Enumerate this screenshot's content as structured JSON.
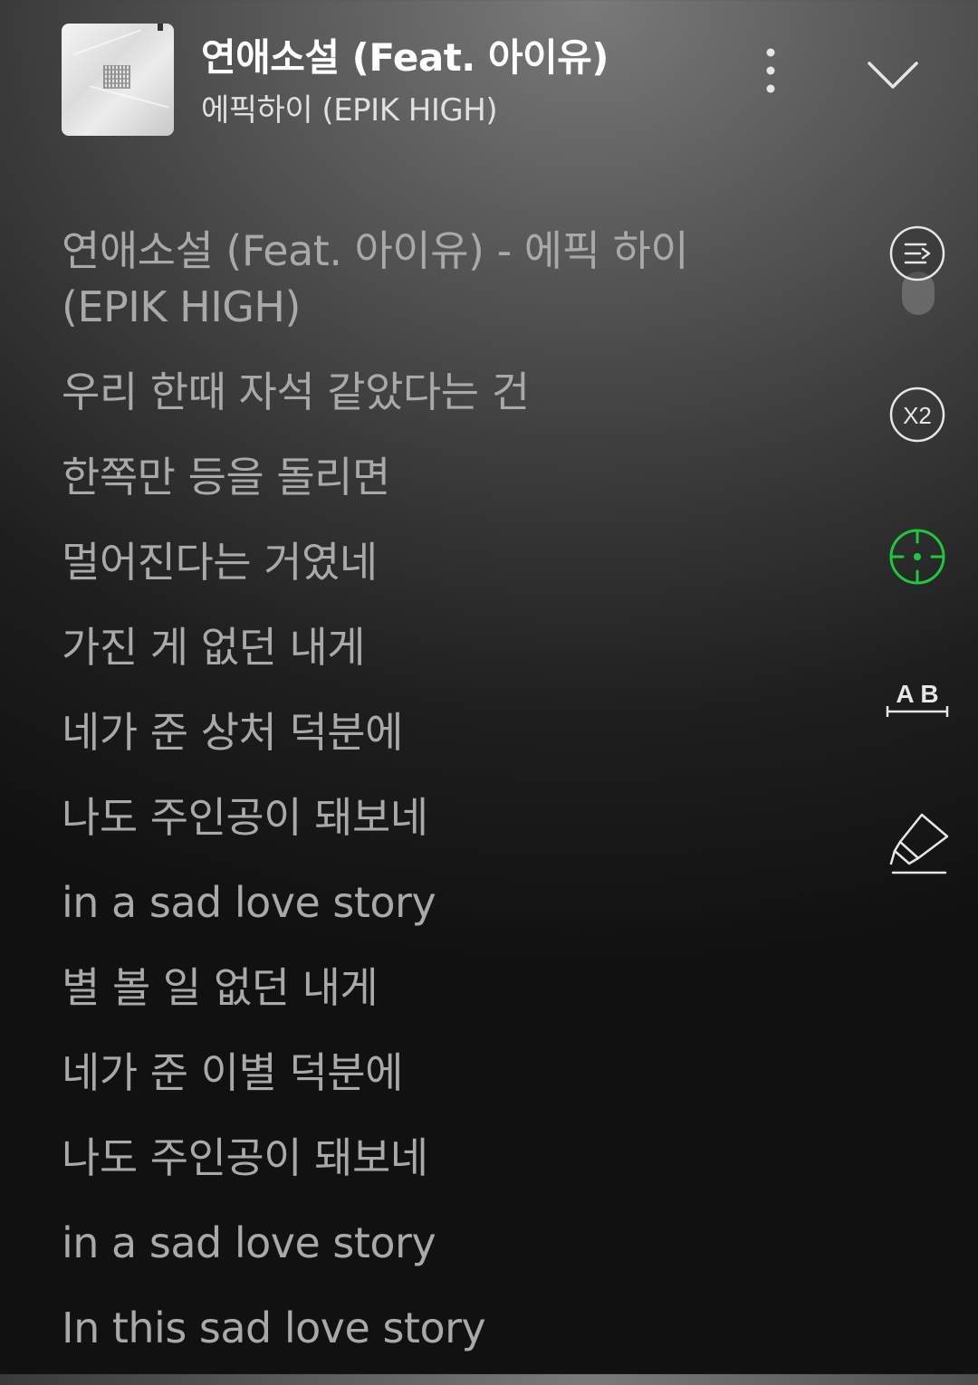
{
  "now_playing": {
    "title": "연애소설 (Feat. 아이유)",
    "artist": "에픽하이 (EPIK HIGH)"
  },
  "header_icons": {
    "more": "more-vertical-icon",
    "collapse": "chevron-down-icon"
  },
  "lyrics": [
    "연애소설 (Feat. 아이유) - 에픽 하이 (EPIK HIGH)",
    "우리 한때 자석 같았다는 건",
    "한쪽만 등을 돌리면",
    "멀어진다는 거였네",
    "가진 게 없던 내게",
    "네가 준 상처 덕분에",
    "나도 주인공이 돼보네",
    "in a sad love story",
    "별 볼 일 없던 내게",
    "네가 준 이별 덕분에",
    "나도 주인공이 돼보네",
    "in a sad love story",
    "In this sad love story"
  ],
  "side_tools": {
    "auto_scroll": "auto-scroll-toggle-icon",
    "speed_label": "X2",
    "focus": "crosshair-icon",
    "ab_label": "A B",
    "highlight": "highlighter-icon"
  },
  "colors": {
    "accent": "#1ec83c",
    "lyric_text": "#a9a9a9",
    "title_text": "#ffffff",
    "icon": "#e6e6e6"
  }
}
